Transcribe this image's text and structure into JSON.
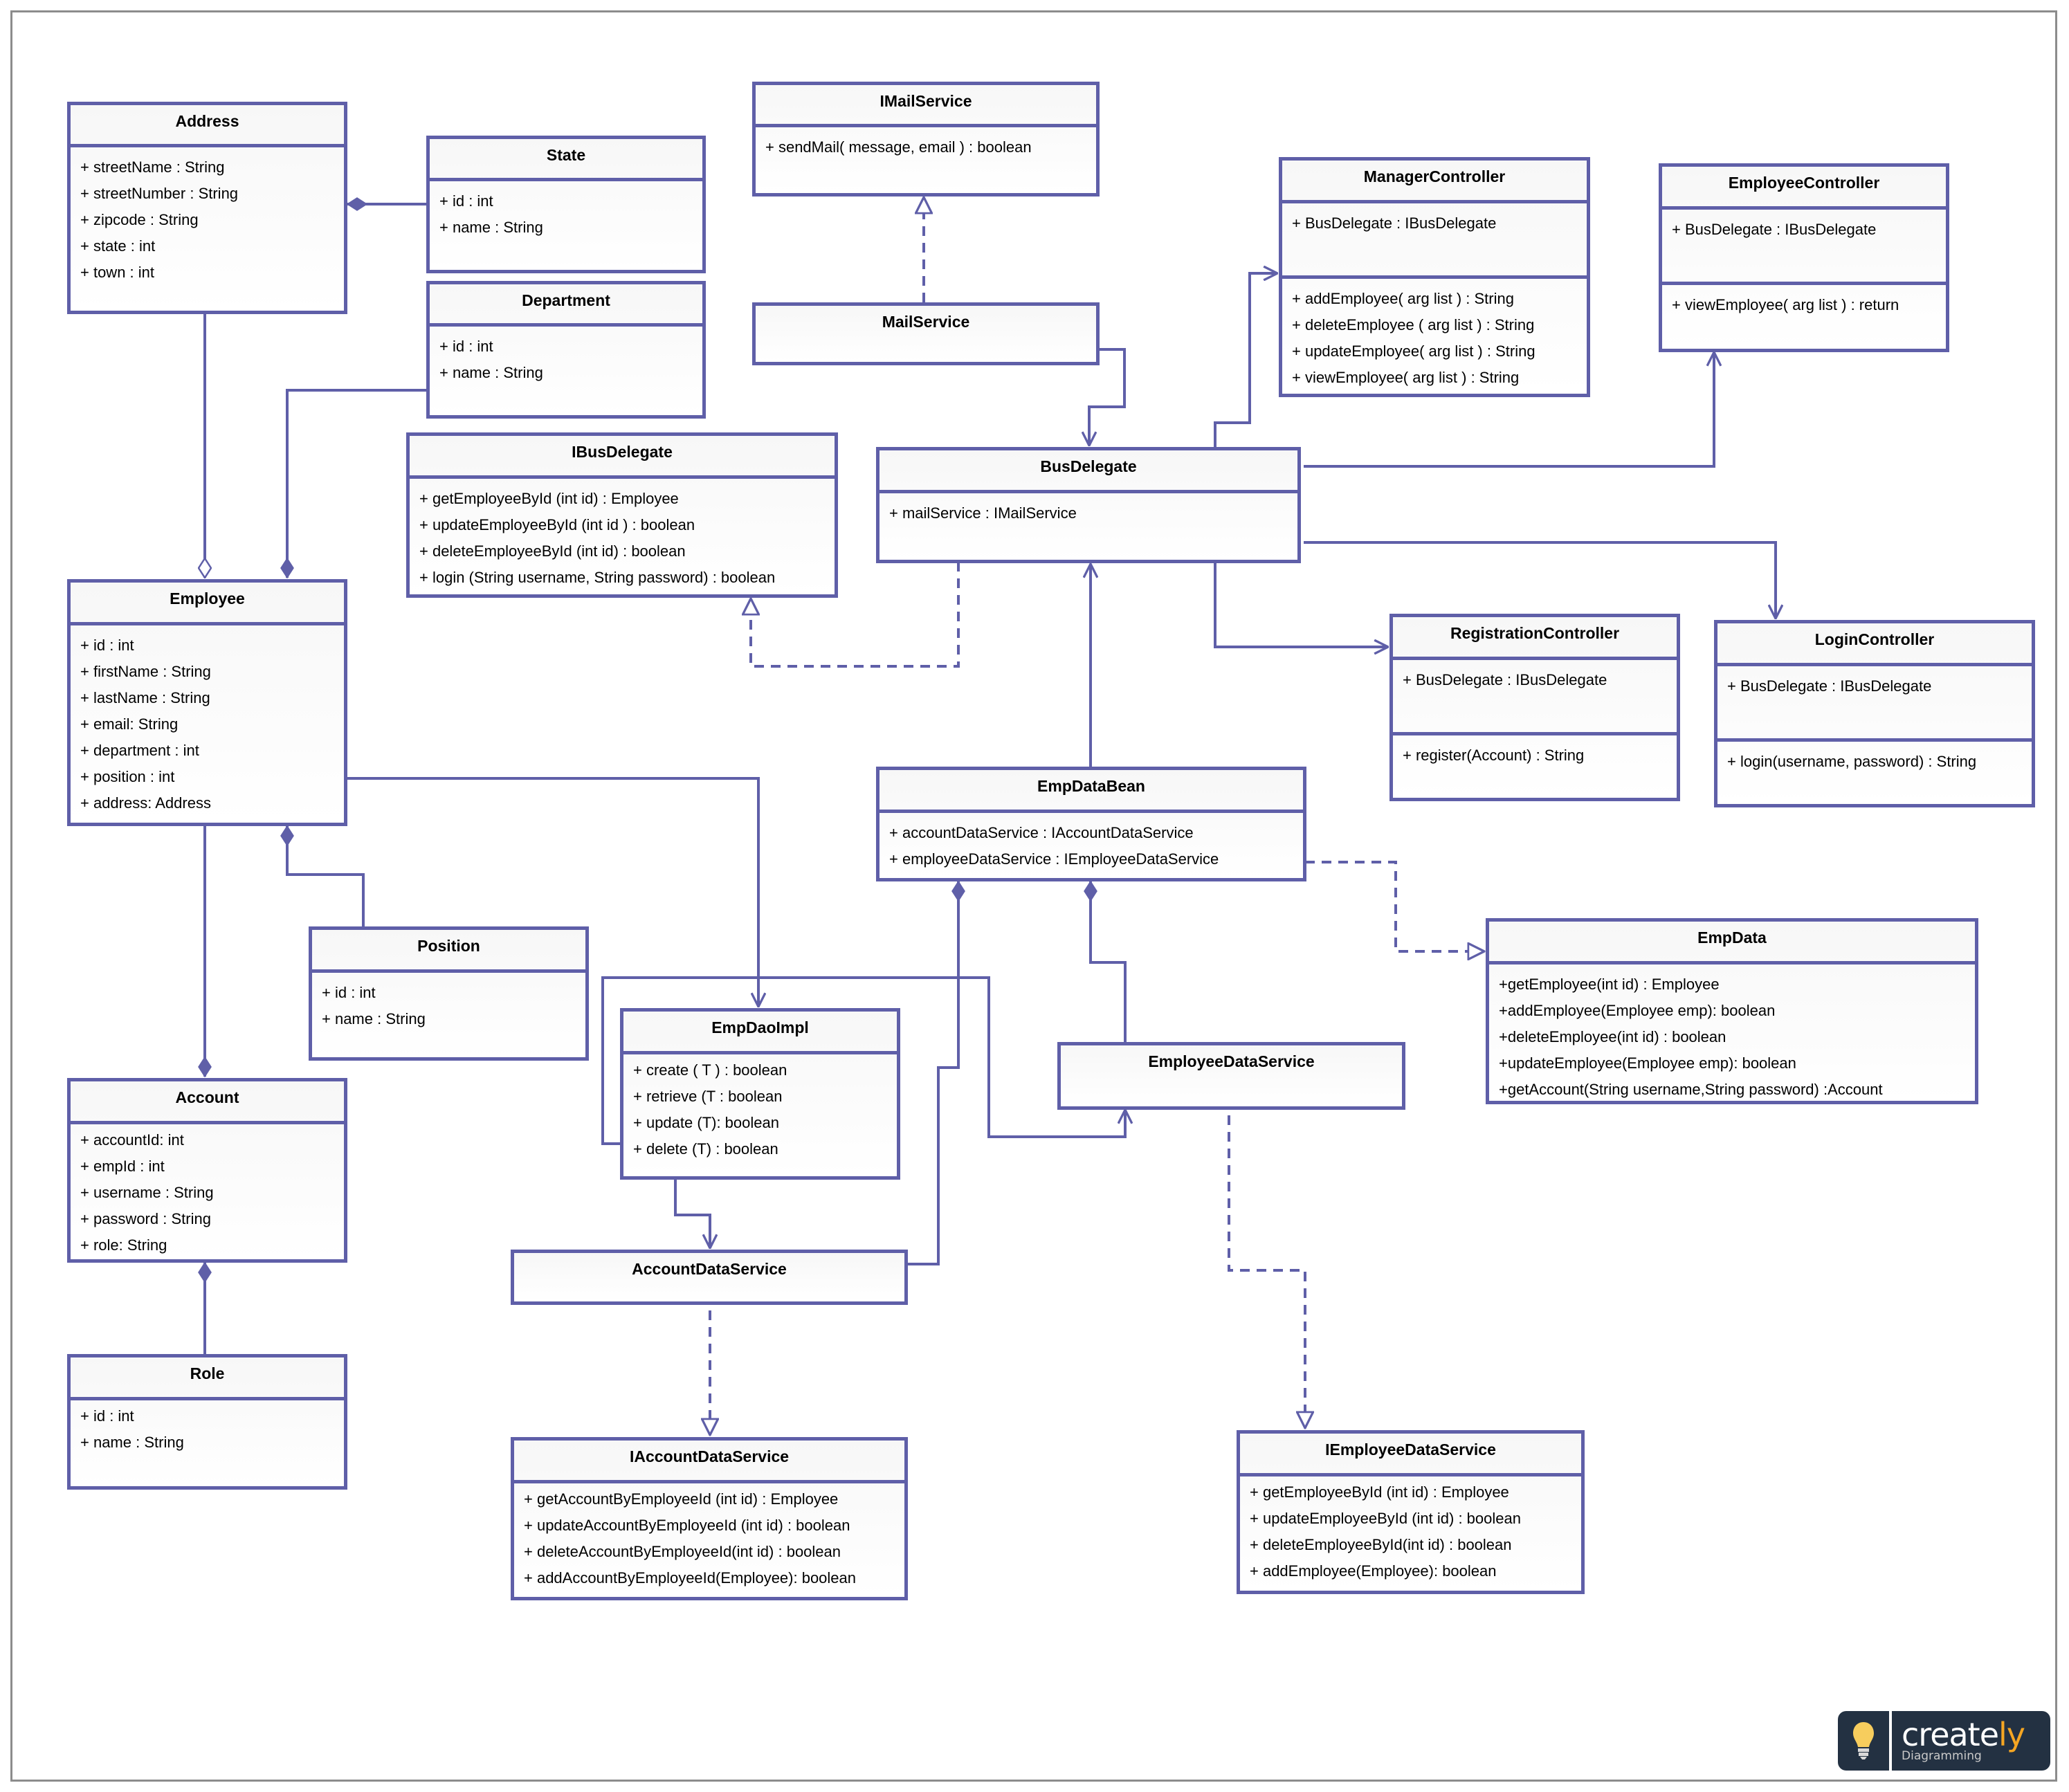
{
  "diagram": {
    "type": "UML class diagram",
    "line_color": "#5f5fa8",
    "classes": {
      "address": {
        "name": "Address",
        "attributes": [
          "+ streetName : String",
          "+ streetNumber : String",
          "+ zipcode : String",
          "+ state : int",
          "+ town : int"
        ]
      },
      "state": {
        "name": "State",
        "attributes": [
          "+ id : int",
          "+ name : String"
        ]
      },
      "department": {
        "name": "Department",
        "attributes": [
          "+ id : int",
          "+ name : String"
        ]
      },
      "imailservice": {
        "name": "IMailService",
        "attributes": [
          "+ sendMail( message, email ) :  boolean"
        ]
      },
      "mailservice": {
        "name": "MailService"
      },
      "managercontroller": {
        "name": "ManagerController",
        "attributes": [
          "+ BusDelegate : IBusDelegate"
        ],
        "operations": [
          "+  addEmployee( arg list ) : String",
          "+ deleteEmployee ( arg list ) : String",
          "+ updateEmployee( arg list ) : String",
          "+ viewEmployee( arg list ) : String"
        ]
      },
      "employeecontroller": {
        "name": "EmployeeController",
        "attributes": [
          "+ BusDelegate : IBusDelegate"
        ],
        "operations": [
          "+ viewEmployee( arg list ) : return"
        ]
      },
      "ibusdelegate": {
        "name": "IBusDelegate",
        "operations": [
          "+ getEmployeeById (int id) : Employee",
          "+ updateEmployeeById (int id ) : boolean",
          "+ deleteEmployeeById (int id) : boolean",
          "+ login (String username, String password) : boolean"
        ]
      },
      "busdelegate": {
        "name": "BusDelegate",
        "attributes": [
          "+ mailService : IMailService"
        ]
      },
      "employee": {
        "name": "Employee",
        "attributes": [
          "+ id : int",
          "+ firstName : String",
          "+ lastName : String",
          "+ email: String",
          "+ department : int",
          "+ position : int",
          "+ address: Address"
        ]
      },
      "registrationcontroller": {
        "name": "RegistrationController",
        "attributes": [
          "+ BusDelegate : IBusDelegate"
        ],
        "operations": [
          "+ register(Account) : String"
        ]
      },
      "logincontroller": {
        "name": "LoginController",
        "attributes": [
          "+ BusDelegate : IBusDelegate"
        ],
        "operations": [
          "+ login(username, password) : String"
        ]
      },
      "empdatabean": {
        "name": "EmpDataBean",
        "attributes": [
          "+ accountDataService : IAccountDataService",
          "+ employeeDataService : IEmployeeDataService"
        ]
      },
      "empdata": {
        "name": "EmpData",
        "operations": [
          "+getEmployee(int id) : Employee",
          "+addEmployee(Employee emp): boolean",
          "+deleteEmployee(int id) : boolean",
          "+updateEmployee(Employee emp): boolean",
          "+getAccount(String username,String password) :Account"
        ]
      },
      "position": {
        "name": "Position",
        "attributes": [
          "+ id : int",
          "+ name : String"
        ]
      },
      "empdaoimpl": {
        "name": "EmpDaoImpl",
        "operations": [
          "+ create ( T ) : boolean",
          "+ retrieve (T : boolean",
          "+ update (T): boolean",
          "+ delete (T) : boolean"
        ]
      },
      "employeedataservice": {
        "name": "EmployeeDataService"
      },
      "account": {
        "name": "Account",
        "attributes": [
          "+ accountId: int",
          "+ empId : int",
          "+ username : String",
          "+ password : String",
          "+ role: String"
        ]
      },
      "accountdataservice": {
        "name": "AccountDataService"
      },
      "role": {
        "name": "Role",
        "attributes": [
          "+ id : int",
          "+ name : String"
        ]
      },
      "iaccountdataservice": {
        "name": "IAccountDataService",
        "operations": [
          "+ getAccountByEmployeeId (int id) : Employee",
          "+ updateAccountByEmployeeId (int id) : boolean",
          "+ deleteAccountByEmployeeId(int id) : boolean",
          "+ addAccountByEmployeeId(Employee): boolean"
        ]
      },
      "iemployeedataservice": {
        "name": "IEmployeeDataService",
        "operations": [
          "+ getEmployeeById (int id) : Employee",
          "+ updateEmployeeById (int id) : boolean",
          "+ deleteEmployeeById(int id) : boolean",
          "+ addEmployee(Employee): boolean"
        ]
      }
    },
    "relationships": [
      {
        "from": "State",
        "to": "Address",
        "type": "composition"
      },
      {
        "from": "Address",
        "to": "Employee",
        "type": "aggregation"
      },
      {
        "from": "Department",
        "to": "Employee",
        "type": "composition"
      },
      {
        "from": "Position",
        "to": "Employee",
        "type": "composition"
      },
      {
        "from": "Account",
        "to": "Employee",
        "type": "composition"
      },
      {
        "from": "Role",
        "to": "Account",
        "type": "composition"
      },
      {
        "from": "MailService",
        "to": "IMailService",
        "type": "realization"
      },
      {
        "from": "MailService",
        "to": "BusDelegate",
        "type": "association"
      },
      {
        "from": "BusDelegate",
        "to": "IBusDelegate",
        "type": "realization"
      },
      {
        "from": "BusDelegate",
        "to": "ManagerController",
        "type": "association"
      },
      {
        "from": "BusDelegate",
        "to": "EmployeeController",
        "type": "association"
      },
      {
        "from": "BusDelegate",
        "to": "RegistrationController",
        "type": "association"
      },
      {
        "from": "BusDelegate",
        "to": "LoginController",
        "type": "association"
      },
      {
        "from": "EmpDataBean",
        "to": "BusDelegate",
        "type": "association"
      },
      {
        "from": "EmpDataBean",
        "to": "EmpData",
        "type": "realization"
      },
      {
        "from": "AccountDataService",
        "to": "EmpDataBean",
        "type": "composition"
      },
      {
        "from": "EmployeeDataService",
        "to": "EmpDataBean",
        "type": "composition"
      },
      {
        "from": "Employee",
        "to": "EmpDaoImpl",
        "type": "association"
      },
      {
        "from": "EmpDaoImpl",
        "to": "AccountDataService",
        "type": "association"
      },
      {
        "from": "EmpDaoImpl",
        "to": "EmployeeDataService",
        "type": "association"
      },
      {
        "from": "AccountDataService",
        "to": "IAccountDataService",
        "type": "realization"
      },
      {
        "from": "EmployeeDataService",
        "to": "IEmployeeDataService",
        "type": "realization"
      }
    ]
  },
  "watermark": {
    "brand_main": "create",
    "brand_accent": "ly",
    "tagline": "Diagramming",
    "accent_color": "#f5a623",
    "bulb_color": "#f7cd5d"
  }
}
